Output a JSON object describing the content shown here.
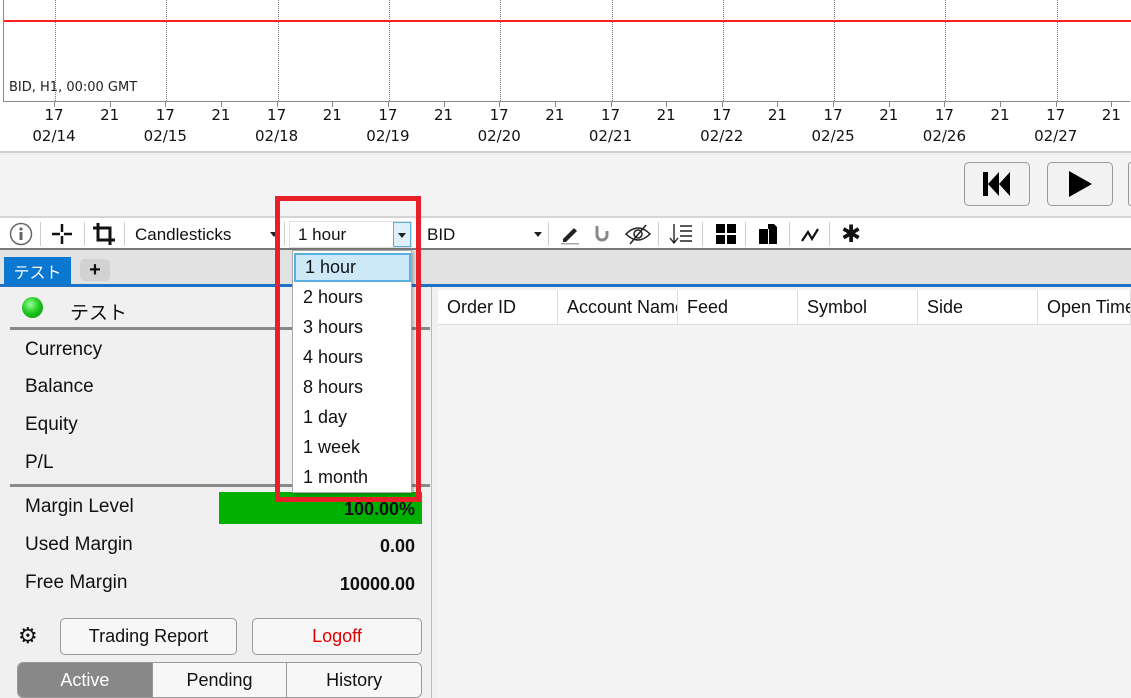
{
  "chart": {
    "label": "BID, H1, 00:00 GMT",
    "hour_labels": [
      "17",
      "21",
      "17",
      "21",
      "17",
      "21",
      "17",
      "21",
      "17",
      "21",
      "17",
      "21",
      "17",
      "21",
      "17",
      "21",
      "17",
      "21",
      "17",
      "21"
    ],
    "date_labels": [
      "02/14",
      "02/15",
      "02/18",
      "02/19",
      "02/20",
      "02/21",
      "02/22",
      "02/25",
      "02/26",
      "02/27"
    ],
    "price_line_color": "#ff2222"
  },
  "playback": {
    "rewind_icon": "skip-to-start-icon",
    "play_icon": "play-icon"
  },
  "toolbar": {
    "chart_type": "Candlesticks",
    "timeframe": "1 hour",
    "price_type": "BID"
  },
  "timeframe_options": [
    "1 hour",
    "2 hours",
    "3 hours",
    "4 hours",
    "8 hours",
    "1 day",
    "1 week",
    "1 month"
  ],
  "tabs": {
    "active": "テスト",
    "add": "+"
  },
  "account": {
    "name": "テスト",
    "status_color": "#22bb22",
    "rows": [
      {
        "label": "Currency"
      },
      {
        "label": "Balance"
      },
      {
        "label": "Equity"
      },
      {
        "label": "P/L"
      }
    ],
    "margin_level_label": "Margin Level",
    "margin_level": "100.00%",
    "margin_color": "#00b000",
    "used_margin_label": "Used Margin",
    "used_margin": "0.00",
    "free_margin_label": "Free Margin",
    "free_margin": "10000.00"
  },
  "buttons": {
    "trading_report": "Trading Report",
    "logoff": "Logoff",
    "logoff_color": "#e00000"
  },
  "segments": [
    "Active",
    "Pending",
    "History"
  ],
  "orders_table": {
    "columns": [
      "Order ID",
      "Account Name",
      "Feed",
      "Symbol",
      "Side",
      "Open Time"
    ]
  }
}
